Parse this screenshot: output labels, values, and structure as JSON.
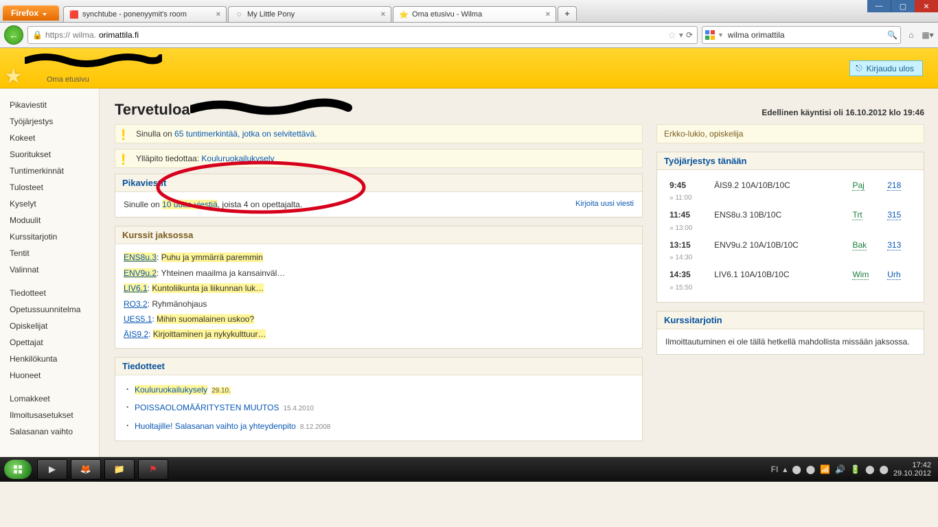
{
  "browser": {
    "button": "Firefox",
    "tabs": [
      {
        "title": "synchtube - ponenyymit's room",
        "fav": "🟥"
      },
      {
        "title": "My Little Pony",
        "fav": "◌"
      },
      {
        "title": "Oma etusivu - Wilma",
        "fav": "⭐",
        "active": true
      }
    ],
    "url_prefix": "https://",
    "url_host": "wilma.",
    "url_rest": "orimattila.fi",
    "search_value": "wilma orimattila"
  },
  "header": {
    "sub": "Oma etusivu",
    "logout": "Kirjaudu ulos"
  },
  "sidebar": {
    "g1": [
      "Pikaviestit",
      "Työjärjestys",
      "Kokeet",
      "Suoritukset",
      "Tuntimerkinnät",
      "Tulosteet",
      "Kyselyt",
      "Moduulit",
      "Kurssitarjotin",
      "Tentit",
      "Valinnat"
    ],
    "g2": [
      "Tiedotteet",
      "Opetussuunnitelma",
      "Opiskelijat",
      "Opettajat",
      "Henkilökunta",
      "Huoneet"
    ],
    "g3": [
      "Lomakkeet",
      "Ilmoitusasetukset",
      "Salasanan vaihto"
    ]
  },
  "main": {
    "heading": "Tervetuloa",
    "last_visit": "Edellinen käyntisi oli 16.10.2012 klo 19:46",
    "alert1_pre": "Sinulla on ",
    "alert1_link": "65 tuntimerkintää, jotka on selvitettävä",
    "alert1_post": ".",
    "alert2_pre": "Ylläpito tiedottaa: ",
    "alert2_link": "Kouluruokailukysely",
    "pika_head": "Pikaviestit",
    "pika_pre": "Sinulle on ",
    "pika_link": "10 uutta viestiä",
    "pika_post": ", joista 4 on opettajalta.",
    "pika_action": "Kirjoita uusi viesti",
    "courses_head": "Kurssit jaksossa",
    "courses": [
      {
        "code": "ENS8u.3",
        "hl": true,
        "desc": "Puhu ja ymmärrä paremmin",
        "desc_hl": true
      },
      {
        "code": "ENV9u.2",
        "hl": true,
        "desc": "Yhteinen maailma ja kansainväl…"
      },
      {
        "code": "LIV6.1",
        "hl": true,
        "desc": "Kuntoliikunta ja liikunnan luk…",
        "desc_hl": true
      },
      {
        "code": "RO3.2",
        "desc": "Ryhmänohjaus"
      },
      {
        "code": "UES5.1",
        "desc": "Mihin suomalainen uskoo?",
        "desc_hl": true
      },
      {
        "code": "ÄIS9.2",
        "desc": "Kirjoittaminen ja nykykulttuur…",
        "desc_hl": true
      }
    ],
    "news_head": "Tiedotteet",
    "news": [
      {
        "title": "Kouluruokailukysely",
        "date": "29.10.",
        "date_hl": true,
        "title_hl": true
      },
      {
        "title": "POISSAOLOMÄÄRITYSTEN MUUTOS",
        "date": "15.4.2010"
      },
      {
        "title": "Huoltajille! Salasanan vaihto ja yhteydenpito",
        "date": "8.12.2008"
      }
    ]
  },
  "right": {
    "info": "Erkko-lukio, opiskelija",
    "sched_head": "Työjärjestys tänään",
    "schedule": [
      {
        "t": "9:45",
        "e": "» 11:00",
        "c": "ÄIS9.2 10A/10B/10C",
        "tc": "Paj",
        "r": "218"
      },
      {
        "t": "11:45",
        "e": "» 13:00",
        "c": "ENS8u.3 10B/10C",
        "tc": "Trt",
        "r": "315"
      },
      {
        "t": "13:15",
        "e": "» 14:30",
        "c": "ENV9u.2 10A/10B/10C",
        "tc": "Bak",
        "r": "313"
      },
      {
        "t": "14:35",
        "e": "» 15:50",
        "c": "LIV6.1 10A/10B/10C",
        "tc": "Wim",
        "r": "Urh"
      }
    ],
    "tray_head": "Kurssitarjotin",
    "tray_text": "Ilmoittautuminen ei ole tällä hetkellä mahdollista missään jaksossa."
  },
  "taskbar": {
    "lang": "FI",
    "time": "17:42",
    "date": "29.10.2012"
  }
}
